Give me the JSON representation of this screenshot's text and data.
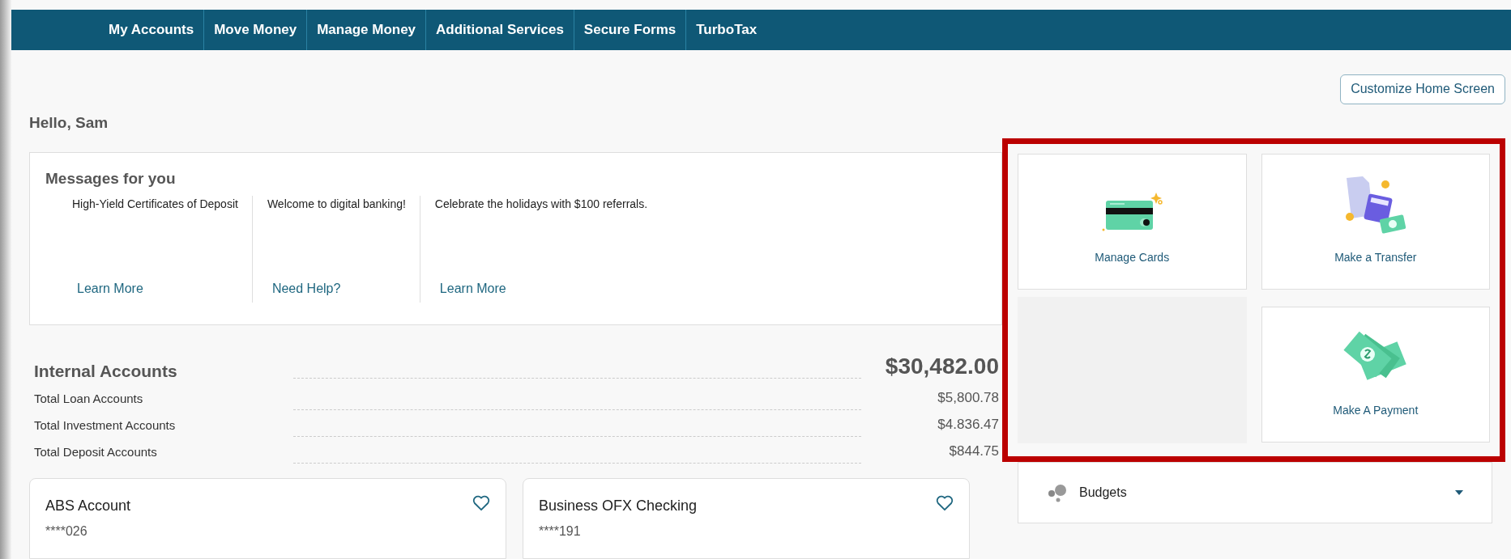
{
  "nav": {
    "items": [
      {
        "label": "My Accounts"
      },
      {
        "label": "Move Money"
      },
      {
        "label": "Manage Money"
      },
      {
        "label": "Additional Services"
      },
      {
        "label": "Secure Forms"
      },
      {
        "label": "TurboTax"
      }
    ]
  },
  "customize_button": "Customize Home Screen",
  "greeting": "Hello, Sam",
  "messages": {
    "title": "Messages for you",
    "items": [
      {
        "text": "High-Yield Certificates of Deposit",
        "link": "Learn More"
      },
      {
        "text": "Welcome to digital banking!",
        "link": "Need Help?"
      },
      {
        "text": "Celebrate the holidays with $100 referrals.",
        "link": "Learn More"
      }
    ]
  },
  "internal_accounts": {
    "title": "Internal Accounts",
    "total": "$30,482.00",
    "rows": [
      {
        "label": "Total Loan Accounts",
        "amount": "$5,800.78"
      },
      {
        "label": "Total Investment Accounts",
        "amount": "$4.836.47"
      },
      {
        "label": "Total Deposit Accounts",
        "amount": "$844.75"
      }
    ]
  },
  "account_cards": [
    {
      "name": "ABS Account",
      "number": "****026",
      "favorite": false
    },
    {
      "name": "Business OFX Checking",
      "number": "****191",
      "favorite": false
    }
  ],
  "tiles": [
    {
      "kind": "cards",
      "label": "Manage Cards"
    },
    {
      "kind": "transfer",
      "label": "Make a Transfer"
    },
    {
      "kind": "empty"
    },
    {
      "kind": "payment",
      "label": "Make A Payment"
    }
  ],
  "budgets": {
    "label": "Budgets",
    "expanded": false
  }
}
